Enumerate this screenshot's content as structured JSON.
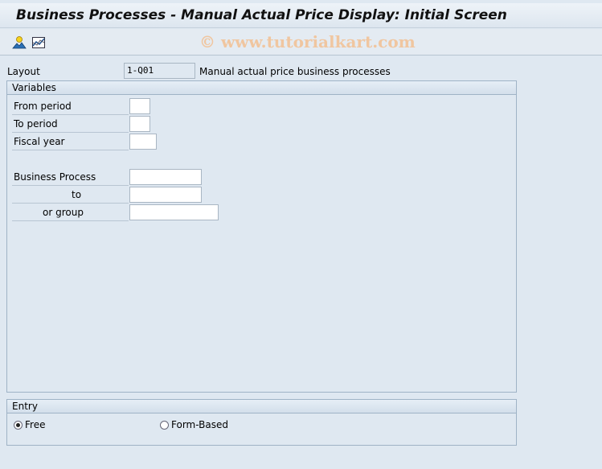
{
  "title": "Business Processes - Manual Actual Price Display: Initial Screen",
  "toolbar": {
    "icons": [
      "user-landscape-icon",
      "chart-icon"
    ],
    "watermark": "© www.tutorialkart.com"
  },
  "layout": {
    "label": "Layout",
    "value": "1-Q01",
    "description": "Manual actual price business processes"
  },
  "variables": {
    "header": "Variables",
    "from_period": {
      "label": "From period",
      "value": ""
    },
    "to_period": {
      "label": "To period",
      "value": ""
    },
    "fiscal_year": {
      "label": "Fiscal year",
      "value": ""
    },
    "business_process": {
      "label": "Business Process",
      "value": ""
    },
    "to": {
      "label": "to",
      "value": ""
    },
    "or_group": {
      "label": "or group",
      "value": ""
    }
  },
  "entry": {
    "header": "Entry",
    "options": [
      {
        "label": "Free",
        "selected": true
      },
      {
        "label": "Form-Based",
        "selected": false
      }
    ]
  }
}
